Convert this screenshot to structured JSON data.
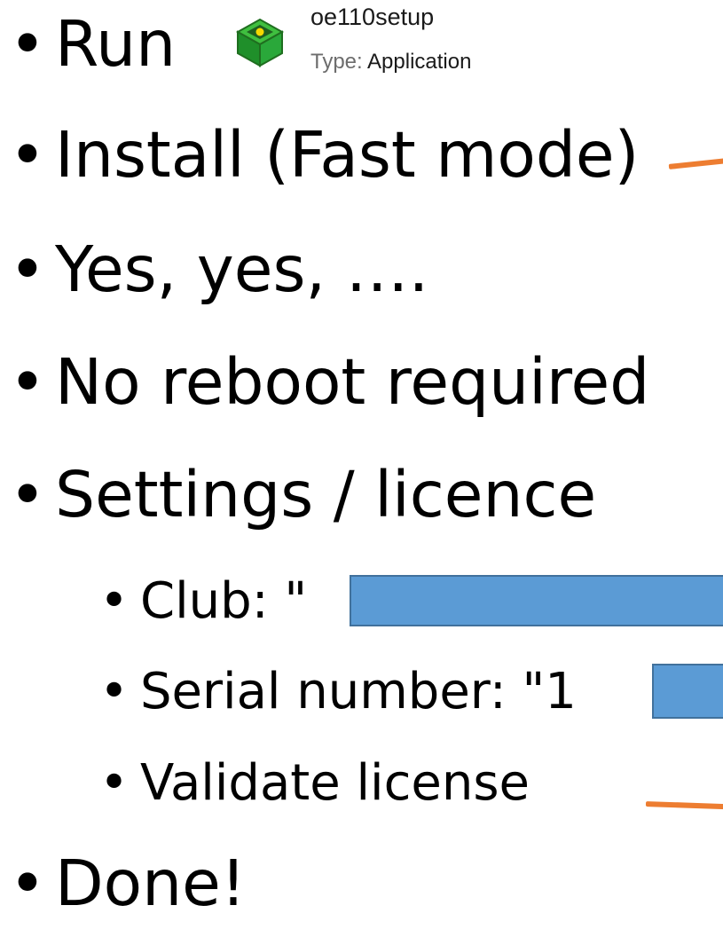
{
  "bullet_char": "•",
  "steps": {
    "run": "Run",
    "install": "Install (Fast mode)",
    "yes": "Yes, yes, ….",
    "no_reboot": "No reboot required",
    "settings": "Settings / licence",
    "done": "Done!"
  },
  "settings_items": {
    "club": "Club: \"",
    "serial": "Serial number: \"",
    "serial_peek": "1",
    "validate": "Validate license"
  },
  "file": {
    "name": "oe110setup",
    "type_label": "Type:",
    "type_value": "Application",
    "icon": "application-installer-icon"
  },
  "colors": {
    "redaction_fill": "#5b9bd5",
    "redaction_border": "#41719c",
    "connector": "#ed7d31"
  }
}
